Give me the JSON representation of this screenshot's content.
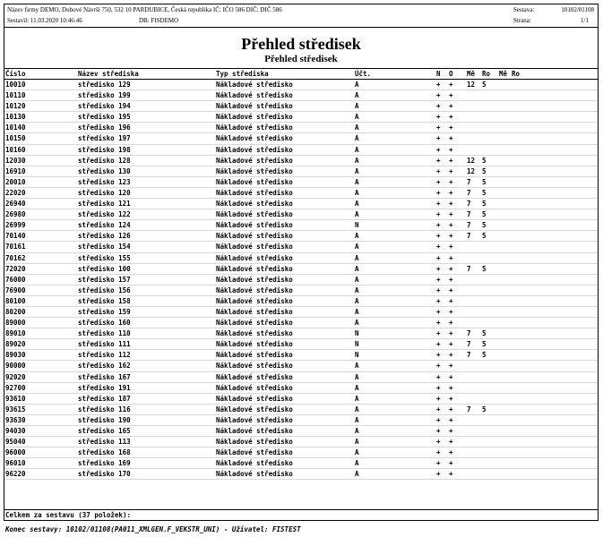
{
  "header": {
    "line1": "Název firmy DEMO, Dubové Návrší 750, 532 10 PARDUBICE, Česká republika  IČ: IČO 586  DIČ: DIČ 586",
    "line2a": "Sestavil: 11.03.2020 10:46:46",
    "line2b": "DB: FISDEMO",
    "sestava_label": "Sestava:",
    "sestava_value": "10102/01108",
    "strana_label": "Strana:",
    "strana_value": "1/1"
  },
  "title": "Přehled středisek",
  "subtitle": "Přehled středisek",
  "columns": {
    "code": "Číslo",
    "name": "Název střediska",
    "type": "Typ střediska",
    "ucet": "Účt.",
    "n": "N",
    "o": "O",
    "me": "Mě",
    "ro": "Ro",
    "me2": "Mě",
    "ro2": "Ro"
  },
  "rows": [
    {
      "code": "10010",
      "name": "středisko 129",
      "type": "Nákladové středisko",
      "ucet": "A",
      "n": "+",
      "o": "+",
      "me": "12",
      "ro": "5"
    },
    {
      "code": "10110",
      "name": "středisko 199",
      "type": "Nákladové středisko",
      "ucet": "A",
      "n": "+",
      "o": "+",
      "me": "",
      "ro": ""
    },
    {
      "code": "10120",
      "name": "středisko 194",
      "type": "Nákladové středisko",
      "ucet": "A",
      "n": "+",
      "o": "+",
      "me": "",
      "ro": ""
    },
    {
      "code": "10130",
      "name": "středisko 195",
      "type": "Nákladové středisko",
      "ucet": "A",
      "n": "+",
      "o": "+",
      "me": "",
      "ro": ""
    },
    {
      "code": "10140",
      "name": "středisko 196",
      "type": "Nákladové středisko",
      "ucet": "A",
      "n": "+",
      "o": "+",
      "me": "",
      "ro": ""
    },
    {
      "code": "10150",
      "name": "středisko 197",
      "type": "Nákladové středisko",
      "ucet": "A",
      "n": "+",
      "o": "+",
      "me": "",
      "ro": ""
    },
    {
      "code": "10160",
      "name": "středisko 198",
      "type": "Nákladové středisko",
      "ucet": "A",
      "n": "+",
      "o": "+",
      "me": "",
      "ro": ""
    },
    {
      "code": "12030",
      "name": "středisko 128",
      "type": "Nákladové středisko",
      "ucet": "A",
      "n": "+",
      "o": "+",
      "me": "12",
      "ro": "5"
    },
    {
      "code": "16910",
      "name": "středisko 130",
      "type": "Nákladové středisko",
      "ucet": "A",
      "n": "+",
      "o": "+",
      "me": "12",
      "ro": "5"
    },
    {
      "code": "20010",
      "name": "středisko 123",
      "type": "Nákladové středisko",
      "ucet": "A",
      "n": "+",
      "o": "+",
      "me": "7",
      "ro": "5"
    },
    {
      "code": "22020",
      "name": "středisko 120",
      "type": "Nákladové středisko",
      "ucet": "A",
      "n": "+",
      "o": "+",
      "me": "7",
      "ro": "5"
    },
    {
      "code": "26940",
      "name": "středisko 121",
      "type": "Nákladové středisko",
      "ucet": "A",
      "n": "+",
      "o": "+",
      "me": "7",
      "ro": "5"
    },
    {
      "code": "26980",
      "name": "středisko 122",
      "type": "Nákladové středisko",
      "ucet": "A",
      "n": "+",
      "o": "+",
      "me": "7",
      "ro": "5"
    },
    {
      "code": "26999",
      "name": "středisko 124",
      "type": "Nákladové středisko",
      "ucet": "N",
      "n": "+",
      "o": "+",
      "me": "7",
      "ro": "5"
    },
    {
      "code": "70140",
      "name": "středisko 126",
      "type": "Nákladové středisko",
      "ucet": "A",
      "n": "+",
      "o": "+",
      "me": "7",
      "ro": "5"
    },
    {
      "code": "70161",
      "name": "středisko 154",
      "type": "Nákladové středisko",
      "ucet": "A",
      "n": "+",
      "o": "+",
      "me": "",
      "ro": ""
    },
    {
      "code": "70162",
      "name": "středisko 155",
      "type": "Nákladové středisko",
      "ucet": "A",
      "n": "+",
      "o": "+",
      "me": "",
      "ro": ""
    },
    {
      "code": "72020",
      "name": "středisko 100",
      "type": "Nákladové středisko",
      "ucet": "A",
      "n": "+",
      "o": "+",
      "me": "7",
      "ro": "5"
    },
    {
      "code": "76000",
      "name": "středisko 157",
      "type": "Nákladové středisko",
      "ucet": "A",
      "n": "+",
      "o": "+",
      "me": "",
      "ro": ""
    },
    {
      "code": "76900",
      "name": "středisko 156",
      "type": "Nákladové středisko",
      "ucet": "A",
      "n": "+",
      "o": "+",
      "me": "",
      "ro": ""
    },
    {
      "code": "80100",
      "name": "středisko 158",
      "type": "Nákladové středisko",
      "ucet": "A",
      "n": "+",
      "o": "+",
      "me": "",
      "ro": ""
    },
    {
      "code": "80200",
      "name": "středisko 159",
      "type": "Nákladové středisko",
      "ucet": "A",
      "n": "+",
      "o": "+",
      "me": "",
      "ro": ""
    },
    {
      "code": "89000",
      "name": "středisko 160",
      "type": "Nákladové středisko",
      "ucet": "A",
      "n": "+",
      "o": "+",
      "me": "",
      "ro": ""
    },
    {
      "code": "89010",
      "name": "středisko 110",
      "type": "Nákladové středisko",
      "ucet": "N",
      "n": "+",
      "o": "+",
      "me": "7",
      "ro": "5"
    },
    {
      "code": "89020",
      "name": "středisko 111",
      "type": "Nákladové středisko",
      "ucet": "N",
      "n": "+",
      "o": "+",
      "me": "7",
      "ro": "5"
    },
    {
      "code": "89030",
      "name": "středisko 112",
      "type": "Nákladové středisko",
      "ucet": "N",
      "n": "+",
      "o": "+",
      "me": "7",
      "ro": "5"
    },
    {
      "code": "90000",
      "name": "středisko 162",
      "type": "Nákladové středisko",
      "ucet": "A",
      "n": "+",
      "o": "+",
      "me": "",
      "ro": ""
    },
    {
      "code": "92020",
      "name": "středisko 167",
      "type": "Nákladové středisko",
      "ucet": "A",
      "n": "+",
      "o": "+",
      "me": "",
      "ro": ""
    },
    {
      "code": "92700",
      "name": "středisko 191",
      "type": "Nákladové středisko",
      "ucet": "A",
      "n": "+",
      "o": "+",
      "me": "",
      "ro": ""
    },
    {
      "code": "93610",
      "name": "středisko 187",
      "type": "Nákladové středisko",
      "ucet": "A",
      "n": "+",
      "o": "+",
      "me": "",
      "ro": ""
    },
    {
      "code": "93615",
      "name": "středisko 116",
      "type": "Nákladové středisko",
      "ucet": "A",
      "n": "+",
      "o": "+",
      "me": "7",
      "ro": "5"
    },
    {
      "code": "93630",
      "name": "středisko 190",
      "type": "Nákladové středisko",
      "ucet": "A",
      "n": "+",
      "o": "+",
      "me": "",
      "ro": ""
    },
    {
      "code": "94030",
      "name": "středisko 165",
      "type": "Nákladové středisko",
      "ucet": "A",
      "n": "+",
      "o": "+",
      "me": "",
      "ro": ""
    },
    {
      "code": "95040",
      "name": "středisko 113",
      "type": "Nákladové středisko",
      "ucet": "A",
      "n": "+",
      "o": "+",
      "me": "",
      "ro": ""
    },
    {
      "code": "96000",
      "name": "středisko 168",
      "type": "Nákladové středisko",
      "ucet": "A",
      "n": "+",
      "o": "+",
      "me": "",
      "ro": ""
    },
    {
      "code": "96010",
      "name": "středisko 169",
      "type": "Nákladové středisko",
      "ucet": "A",
      "n": "+",
      "o": "+",
      "me": "",
      "ro": ""
    },
    {
      "code": "96220",
      "name": "středisko 170",
      "type": "Nákladové středisko",
      "ucet": "A",
      "n": "+",
      "o": "+",
      "me": "",
      "ro": ""
    }
  ],
  "total_label": "Celkem za sestavu (37 položek):",
  "footer": "Konec sestavy: 10102/01108(PA011_XMLGEN.F_VEKSTR_UNI) - Uživatel: FISTEST"
}
